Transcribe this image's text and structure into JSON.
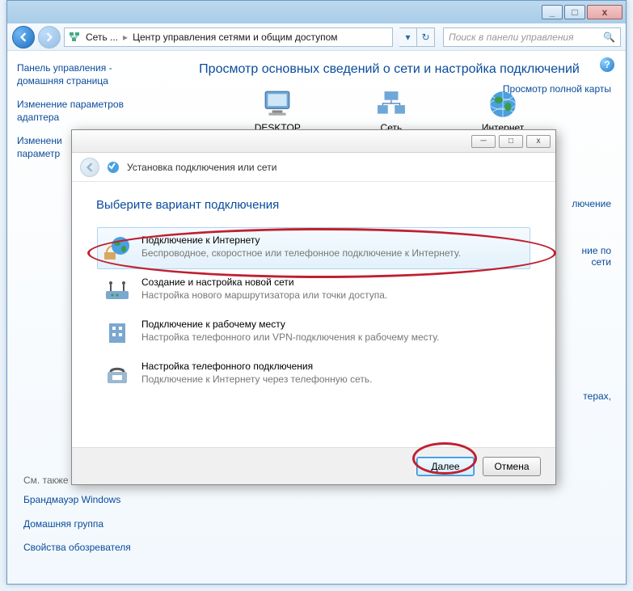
{
  "titlebar": {
    "min": "_",
    "max": "□",
    "close": "x"
  },
  "toolbar": {
    "crumb1": "Сеть ...",
    "crumb2": "Центр управления сетями и общим доступом",
    "searchPlaceholder": "Поиск в панели управления"
  },
  "sidebar": {
    "link1": "Панель управления - домашняя страница",
    "link2": "Изменение параметров адаптера",
    "link3": "Изменени\nпараметр",
    "seeAlso": "См. также",
    "b1": "Брандмауэр Windows",
    "b2": "Домашняя группа",
    "b3": "Свойства обозревателя"
  },
  "main": {
    "heading": "Просмотр основных сведений о сети и настройка подключений",
    "mapLink": "Просмотр полной карты",
    "node1": "DESKTOP",
    "node2": "Сеть",
    "node3": "Интернет",
    "r2": "лючение",
    "r3": "ние по сети",
    "r4": "терах,"
  },
  "dialog": {
    "tb": {
      "min": "─",
      "max": "□",
      "close": "x"
    },
    "title": "Установка подключения или сети",
    "heading": "Выберите вариант подключения",
    "options": [
      {
        "t": "Подключение к Интернету",
        "d": "Беспроводное, скоростное или телефонное подключение к Интернету."
      },
      {
        "t": "Создание и настройка новой сети",
        "d": "Настройка нового маршрутизатора или точки доступа."
      },
      {
        "t": "Подключение к рабочему месту",
        "d": "Настройка телефонного или VPN-подключения к рабочему месту."
      },
      {
        "t": "Настройка телефонного подключения",
        "d": "Подключение к Интернету через телефонную сеть."
      }
    ],
    "next": "Далее",
    "cancel": "Отмена"
  }
}
